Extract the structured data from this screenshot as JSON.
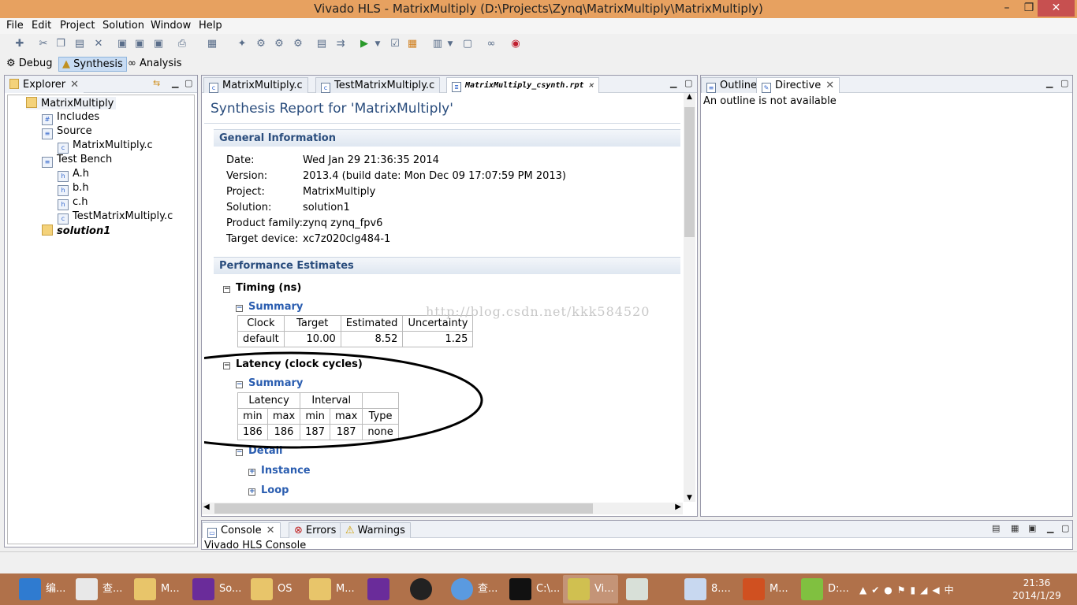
{
  "window": {
    "title": "Vivado HLS - MatrixMultiply (D:\\Projects\\Zynq\\MatrixMultiply\\MatrixMultiply)"
  },
  "menu": [
    "File",
    "Edit",
    "Project",
    "Solution",
    "Window",
    "Help"
  ],
  "perspectives": {
    "debug": "Debug",
    "synthesis": "Synthesis",
    "analysis": "Analysis"
  },
  "explorer": {
    "tab": "Explorer",
    "project": "MatrixMultiply",
    "items": [
      "Includes",
      "Source",
      "MatrixMultiply.c",
      "Test Bench",
      "A.h",
      "b.h",
      "c.h",
      "TestMatrixMultiply.c",
      "solution1"
    ]
  },
  "editor": {
    "tabs": [
      "MatrixMultiply.c",
      "TestMatrixMultiply.c",
      "MatrixMultiply_csynth.rpt"
    ],
    "report_title": "Synthesis Report for 'MatrixMultiply'",
    "general_header": "General Information",
    "general": {
      "labels": [
        "Date:",
        "Version:",
        "Project:",
        "Solution:",
        "Product family:",
        "Target device:"
      ],
      "values": [
        "Wed Jan 29 21:36:35 2014",
        "2013.4 (build date: Mon Dec 09 17:07:59 PM 2013)",
        "MatrixMultiply",
        "solution1",
        "zynq zynq_fpv6",
        "xc7z020clg484-1"
      ]
    },
    "perf_header": "Performance Estimates",
    "timing_title": "Timing (ns)",
    "summary": "Summary",
    "timing_table": {
      "headers": [
        "Clock",
        "Target",
        "Estimated",
        "Uncertainty"
      ],
      "row": [
        "default",
        "10.00",
        "8.52",
        "1.25"
      ]
    },
    "latency_title": "Latency (clock cycles)",
    "latency_table": {
      "group": [
        "Latency",
        "Interval"
      ],
      "headers": [
        "min",
        "max",
        "min",
        "max",
        "Type"
      ],
      "row": [
        "186",
        "186",
        "187",
        "187",
        "none"
      ]
    },
    "detail": "Detail",
    "instance": "Instance",
    "loop": "Loop",
    "watermark": "http://blog.csdn.net/kkk584520"
  },
  "outline": {
    "tabs": [
      "Outline",
      "Directive"
    ],
    "message": "An outline is not available"
  },
  "console": {
    "tabs": [
      "Console",
      "Errors",
      "Warnings"
    ],
    "text": "Vivado HLS Console"
  },
  "taskbar": {
    "items": [
      "编...",
      "查...",
      "M...",
      "So...",
      "OS",
      "M...",
      "",
      "",
      "查...",
      "C:\\...",
      "Vi...",
      "",
      "8....",
      "M...",
      "D:..."
    ],
    "time": "21:36",
    "date": "2014/1/29"
  }
}
